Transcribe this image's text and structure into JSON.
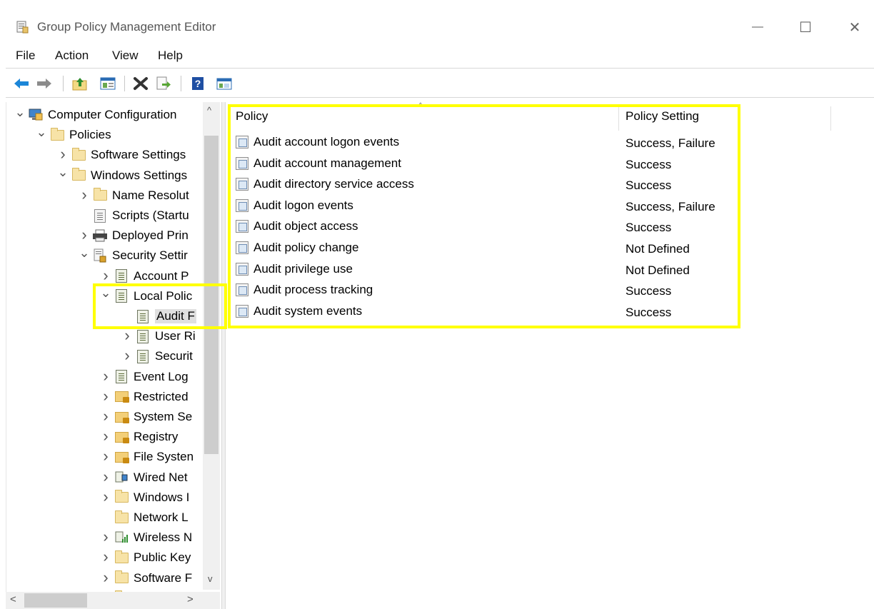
{
  "window": {
    "title": "Group Policy Management Editor",
    "minimize_glyph": "—",
    "maximize_glyph": "☐",
    "close_glyph": "✕"
  },
  "menu": [
    "File",
    "Action",
    "View",
    "Help"
  ],
  "toolbar": {
    "icons": [
      "back-arrow-icon",
      "forward-arrow-icon",
      "up-folder-icon",
      "show-hide-console-tree-icon",
      "delete-icon",
      "export-list-icon",
      "help-icon",
      "properties-view-icon"
    ]
  },
  "tree": {
    "nodes": [
      {
        "label": "Computer Configuration",
        "level": 0,
        "expander": "expanded",
        "icon": "computer-icon"
      },
      {
        "label": "Policies",
        "level": 1,
        "expander": "expanded",
        "icon": "folder-icon"
      },
      {
        "label": "Software Settings",
        "level": 2,
        "expander": "collapsed",
        "icon": "folder-icon"
      },
      {
        "label": "Windows Settings",
        "level": 2,
        "expander": "expanded",
        "icon": "folder-icon"
      },
      {
        "label": "Name Resolut",
        "level": 3,
        "expander": "collapsed",
        "icon": "folder-icon"
      },
      {
        "label": "Scripts (Startu",
        "level": 3,
        "expander": "none",
        "icon": "scripts-icon"
      },
      {
        "label": "Deployed Prin",
        "level": 3,
        "expander": "collapsed",
        "icon": "printer-icon"
      },
      {
        "label": "Security Settir",
        "level": 3,
        "expander": "expanded",
        "icon": "security-settings-icon"
      },
      {
        "label": "Account P",
        "level": 4,
        "expander": "collapsed",
        "icon": "policy-book-icon"
      },
      {
        "label": "Local Polic",
        "level": 4,
        "expander": "expanded",
        "icon": "policy-book-icon"
      },
      {
        "label": "Audit F",
        "level": 5,
        "expander": "none",
        "icon": "policy-book-icon"
      },
      {
        "label": "User Ri",
        "level": 5,
        "expander": "collapsed",
        "icon": "policy-book-icon"
      },
      {
        "label": "Securit",
        "level": 5,
        "expander": "collapsed",
        "icon": "policy-book-icon"
      },
      {
        "label": "Event Log",
        "level": 4,
        "expander": "collapsed",
        "icon": "policy-book-icon"
      },
      {
        "label": "Restricted",
        "level": 4,
        "expander": "collapsed",
        "icon": "locked-folder-icon"
      },
      {
        "label": "System Se",
        "level": 4,
        "expander": "collapsed",
        "icon": "locked-folder-icon"
      },
      {
        "label": "Registry",
        "level": 4,
        "expander": "collapsed",
        "icon": "locked-folder-icon"
      },
      {
        "label": "File Systen",
        "level": 4,
        "expander": "collapsed",
        "icon": "locked-folder-icon"
      },
      {
        "label": "Wired Net",
        "level": 4,
        "expander": "collapsed",
        "icon": "wired-network-icon"
      },
      {
        "label": "Windows I",
        "level": 4,
        "expander": "collapsed",
        "icon": "folder-icon"
      },
      {
        "label": "Network L",
        "level": 4,
        "expander": "none",
        "icon": "folder-icon"
      },
      {
        "label": "Wireless N",
        "level": 4,
        "expander": "collapsed",
        "icon": "wireless-network-icon"
      },
      {
        "label": "Public Key",
        "level": 4,
        "expander": "collapsed",
        "icon": "folder-icon"
      },
      {
        "label": "Software F",
        "level": 4,
        "expander": "collapsed",
        "icon": "folder-icon"
      },
      {
        "label": "",
        "level": 4,
        "expander": "none",
        "icon": "folder-icon"
      }
    ],
    "selected_label": "Audit F",
    "scrollbar": {
      "up_arrow": "^",
      "down_arrow": "v",
      "left_arrow": "<",
      "right_arrow": ">"
    }
  },
  "list": {
    "columns": [
      "Policy",
      "Policy Setting"
    ],
    "sort_glyph": "^",
    "rows": [
      {
        "policy": "Audit account logon events",
        "setting": "Success, Failure"
      },
      {
        "policy": "Audit account management",
        "setting": "Success"
      },
      {
        "policy": "Audit directory service access",
        "setting": "Success"
      },
      {
        "policy": "Audit logon events",
        "setting": "Success, Failure"
      },
      {
        "policy": "Audit object access",
        "setting": "Success"
      },
      {
        "policy": "Audit policy change",
        "setting": "Not Defined"
      },
      {
        "policy": "Audit privilege use",
        "setting": "Not Defined"
      },
      {
        "policy": "Audit process tracking",
        "setting": "Success"
      },
      {
        "policy": "Audit system events",
        "setting": "Success"
      }
    ]
  },
  "colors": {
    "highlight": "#ffff00"
  }
}
